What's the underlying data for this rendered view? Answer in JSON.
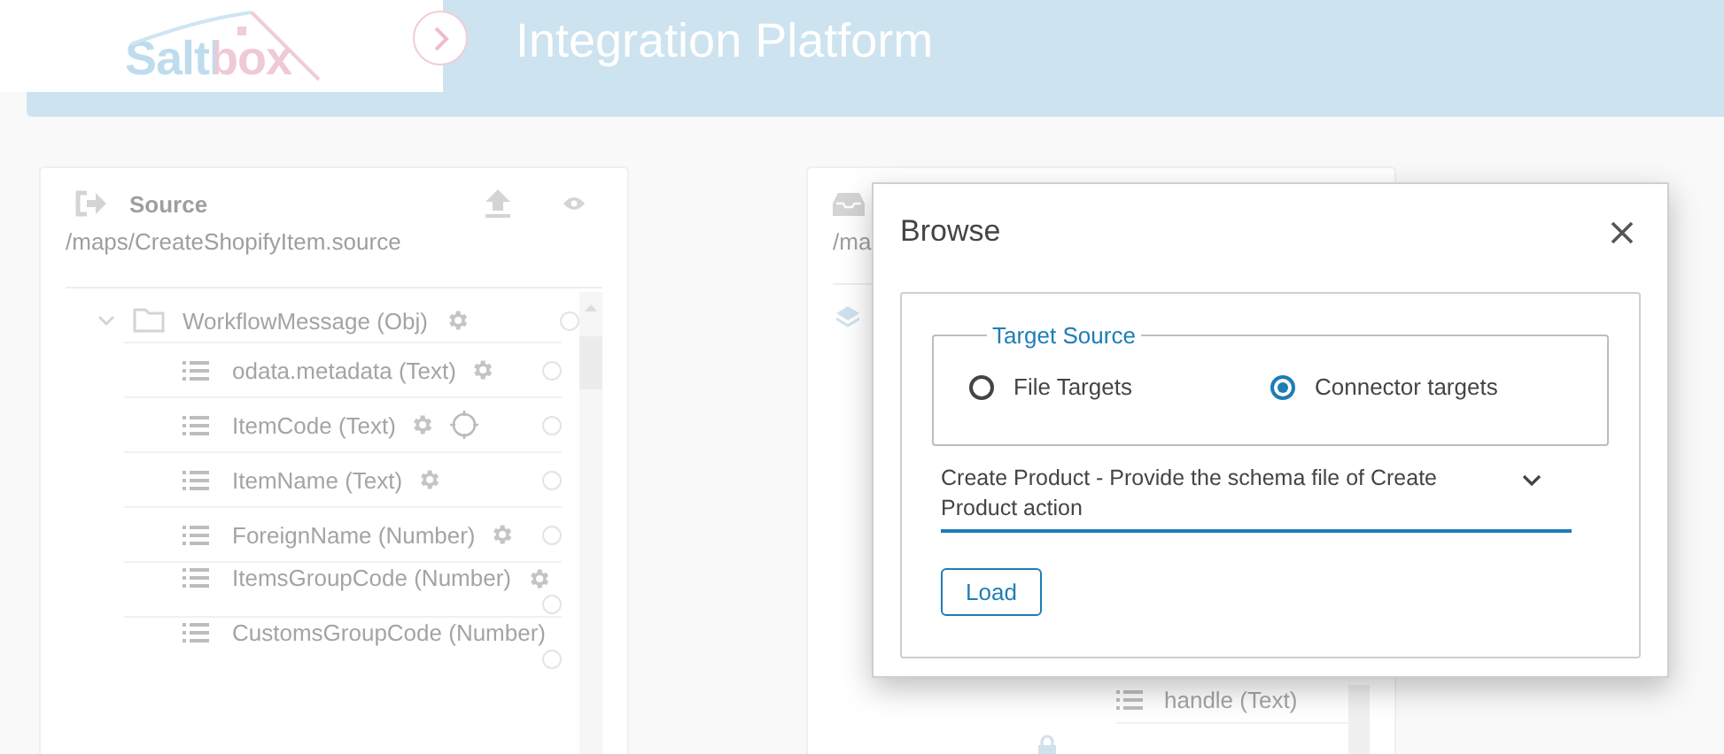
{
  "header": {
    "logo": "Saltbox",
    "title": "Integration Platform"
  },
  "source_panel": {
    "title": "Source",
    "path": "/maps/CreateShopifyItem.source",
    "tree": [
      {
        "label": "WorkflowMessage (Obj)",
        "expanded": true,
        "children": [
          {
            "label": "odata.metadata (Text)",
            "gear": true,
            "targeted": false
          },
          {
            "label": "ItemCode (Text)",
            "gear": true,
            "targeted": true
          },
          {
            "label": "ItemName (Text)",
            "gear": true,
            "targeted": false
          },
          {
            "label": "ForeignName (Number)",
            "gear": true,
            "targeted": false
          },
          {
            "label": "ItemsGroupCode (Number)",
            "gear": true,
            "targeted": false
          },
          {
            "label": "CustomsGroupCode (Number)",
            "gear": false,
            "targeted": false
          }
        ]
      }
    ]
  },
  "target_panel": {
    "path": "/ma",
    "rows": [
      {
        "label": "handle (Text)",
        "locked": false
      }
    ]
  },
  "dialog": {
    "title": "Browse",
    "group_label": "Target Source",
    "options": [
      {
        "label": "File Targets",
        "selected": false
      },
      {
        "label": "Connector targets",
        "selected": true
      }
    ],
    "select_value": "Create Product - Provide the schema file of Create Product action",
    "button": "Load"
  }
}
